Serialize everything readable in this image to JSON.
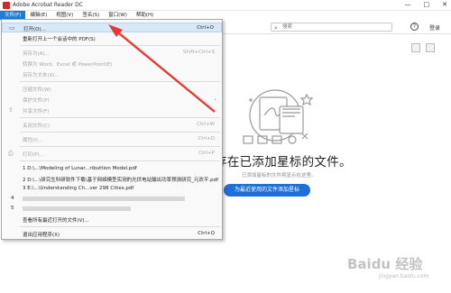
{
  "window": {
    "title": "Adobe Acrobat Reader DC",
    "controls": [
      "—",
      "□",
      "✕"
    ]
  },
  "menubar": {
    "items": [
      "文件(F)",
      "编辑(E)",
      "视图(V)",
      "签名(S)",
      "窗口(W)",
      "帮助(H)"
    ]
  },
  "toolbar": {
    "search_placeholder": "搜索",
    "help": "?",
    "login": "登录"
  },
  "empty_state": {
    "title": "存在已添加星标的文件。",
    "subtitle": "已添加星标的文件将显示在这里。",
    "button": "为最近使用的文件添加星标"
  },
  "file_menu": {
    "items": [
      {
        "label": "打开(O)...",
        "shortcut": "Ctrl+O",
        "icon": "folder-open-icon",
        "disabled": false
      },
      {
        "label": "重新打开上一个会话中的 PDF(S)",
        "shortcut": "",
        "icon": "",
        "disabled": false
      },
      {
        "label": "另存为(A)...",
        "shortcut": "Shift+Ctrl+S",
        "icon": "",
        "disabled": true
      },
      {
        "label": "转换为 Word、Excel 或 PowerPoint(E)",
        "shortcut": "",
        "icon": "",
        "disabled": true
      },
      {
        "label": "另存为文本(X)...",
        "shortcut": "",
        "icon": "",
        "disabled": true
      },
      {
        "label": "压缩文件(W)",
        "shortcut": "",
        "icon": "",
        "disabled": true
      },
      {
        "label": "保护文件(P)",
        "shortcut": "",
        "icon": "",
        "disabled": true
      },
      {
        "label": "共享文件(F)",
        "shortcut": "",
        "icon": "share-icon",
        "disabled": true
      },
      {
        "label": "关闭文件(C)",
        "shortcut": "Ctrl+W",
        "icon": "",
        "disabled": true
      },
      {
        "label": "属性(I)...",
        "shortcut": "Ctrl+D",
        "icon": "",
        "disabled": true
      },
      {
        "label": "打印(P)...",
        "shortcut": "Ctrl+P",
        "icon": "printer-icon",
        "disabled": true
      }
    ],
    "recent": [
      "1 D:\\...\\Modeling of Lunar...ributtion Model.pdf",
      "2 D:\\...\\研究生科研软件下载\\基于网络模型实测的光伏电站输出功率预测研究_元欢平.pdf",
      "3 E:\\...\\Understanding Ch...ver 298 Cities.pdf",
      "4",
      "5"
    ],
    "view_all": "查看所有最近打开的文件(V)...",
    "exit": {
      "label": "退出应用程序(X)",
      "shortcut": "Ctrl+Q"
    }
  },
  "watermark": {
    "logo": "Baidu 经验",
    "url": "jingyan.baidu.com"
  },
  "colors": {
    "accent": "#1e7bd6",
    "button": "#1e6fd9",
    "arrow": "#e53935"
  }
}
